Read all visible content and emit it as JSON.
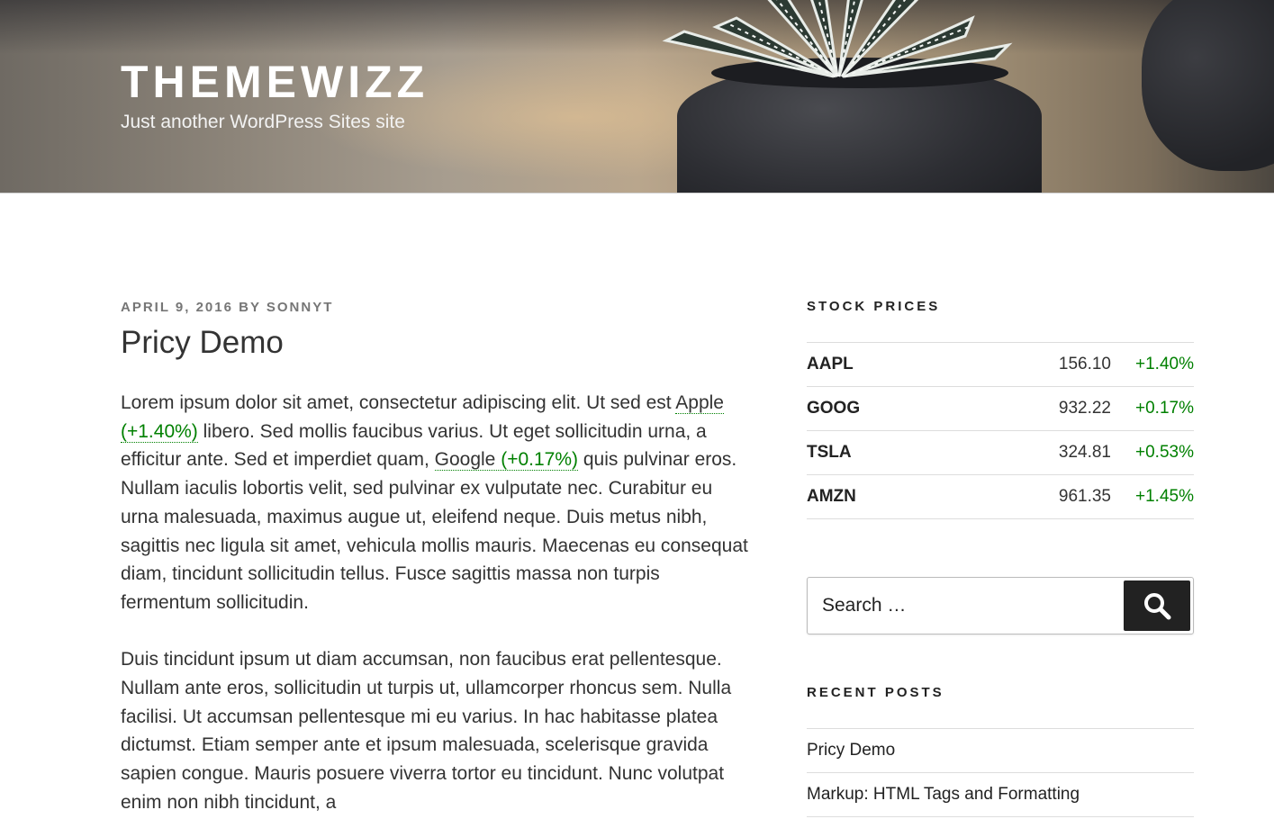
{
  "header": {
    "site_title": "THEMEWIZZ",
    "site_description": "Just another WordPress Sites site"
  },
  "post": {
    "date": "APRIL 9, 2016",
    "by": "BY",
    "author": "SONNYT",
    "title": "Pricy Demo",
    "p1": {
      "a": "Lorem ipsum dolor sit amet, consectetur adipiscing elit. Ut sed est ",
      "link1_name": "Apple",
      "link1_change": "(+1.40%)",
      "b": " libero. Sed mollis faucibus varius. Ut eget sollicitudin urna, a efficitur ante. Sed et imperdiet quam, ",
      "link2_name": "Google",
      "link2_change": "(+0.17%)",
      "c": " quis pulvinar eros. Nullam iaculis lobortis velit, sed pulvinar ex vulputate nec. Curabitur eu urna malesuada, maximus augue ut, eleifend neque. Duis metus nibh, sagittis nec ligula sit amet, vehicula mollis mauris. Maecenas eu consequat diam, tincidunt sollicitudin tellus. Fusce sagittis massa non turpis fermentum sollicitudin."
    },
    "p2": "Duis tincidunt ipsum ut diam accumsan, non faucibus erat pellentesque. Nullam ante eros, sollicitudin ut turpis ut, ullamcorper rhoncus sem. Nulla facilisi. Ut accumsan pellentesque mi eu varius. In hac habitasse platea dictumst. Etiam semper ante et ipsum malesuada, scelerisque gravida sapien congue. Mauris posuere viverra tortor eu tincidunt. Nunc volutpat enim non nibh tincidunt, a"
  },
  "sidebar": {
    "stock_title": "STOCK PRICES",
    "stocks": [
      {
        "symbol": "AAPL",
        "price": "156.10",
        "change": "+1.40%"
      },
      {
        "symbol": "GOOG",
        "price": "932.22",
        "change": "+0.17%"
      },
      {
        "symbol": "TSLA",
        "price": "324.81",
        "change": "+0.53%"
      },
      {
        "symbol": "AMZN",
        "price": "961.35",
        "change": "+1.45%"
      }
    ],
    "search": {
      "placeholder": "Search …",
      "icon": "search-icon"
    },
    "recent_title": "RECENT POSTS",
    "recent_posts": [
      "Pricy Demo",
      "Markup: HTML Tags and Formatting"
    ]
  },
  "colors": {
    "positive": "#008000",
    "button_bg": "#222222"
  }
}
